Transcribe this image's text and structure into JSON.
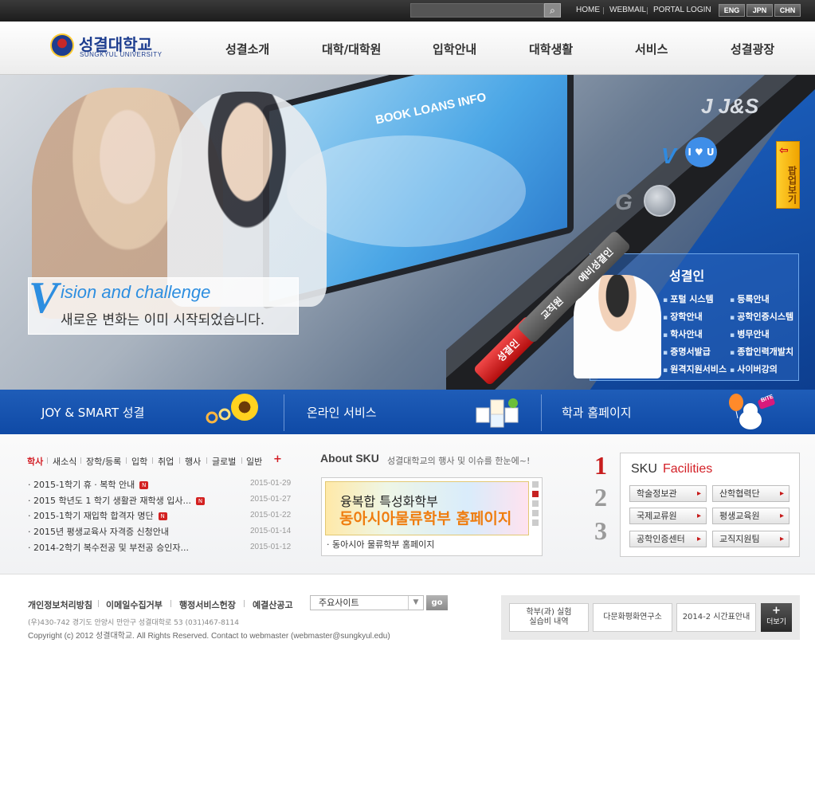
{
  "topbar": {
    "search_placeholder": "",
    "links": [
      "HOME",
      "WEBMAIL",
      "PORTAL LOGIN"
    ],
    "languages": [
      "ENG",
      "JPN",
      "CHN"
    ]
  },
  "header": {
    "logo_ko": "성결대학교",
    "logo_en": "SUNGKYUL UNIVERSITY",
    "nav": [
      "성결소개",
      "대학/대학원",
      "입학안내",
      "대학생활",
      "서비스",
      "성결광장"
    ]
  },
  "hero": {
    "board_title": "BOOK LOANS INFO",
    "vision_v": "V",
    "vision_title": "ision and challenge",
    "vision_sub": "새로운 변화는 이미 시작되었습니다.",
    "letter_js": "J J&S",
    "letter_v": "V",
    "bubble_text": "I ♥ U",
    "letter_g": "G",
    "popup_label": "팝업보기",
    "tabs": [
      "성결인",
      "교직원",
      "예비성결인"
    ],
    "portal_title": "성결인",
    "portal_links_left": [
      "포털 시스템",
      "장학안내",
      "학사안내",
      "증명서발급",
      "원격지원서비스"
    ],
    "portal_links_right": [
      "등록안내",
      "공학인증시스템",
      "병무안내",
      "종합인력개발치",
      "사이버강의"
    ]
  },
  "quickbar": {
    "items": [
      "JOY & SMART 성결",
      "온라인 서비스",
      "학과 홈페이지"
    ],
    "bite_label": "BITE"
  },
  "news": {
    "tabs": [
      "학사",
      "새소식",
      "장학/등록",
      "입학",
      "취업",
      "행사",
      "글로벌",
      "일반"
    ],
    "plus": "+",
    "new_badge": "N",
    "items": [
      {
        "title": "· 2015-1학기 휴 · 복학 안내",
        "date": "2015-01-29",
        "is_new": true
      },
      {
        "title": "· 2015 학년도 1 학기 생활관 재학생 입사...",
        "date": "2015-01-27",
        "is_new": true
      },
      {
        "title": "· 2015-1학기 재입학 합격자 명단",
        "date": "2015-01-22",
        "is_new": true
      },
      {
        "title": "· 2015년 평생교육사 자격증 신청안내",
        "date": "2015-01-14",
        "is_new": false
      },
      {
        "title": "· 2014-2학기 복수전공 및 부전공 승인자...",
        "date": "2015-01-12",
        "is_new": false
      }
    ]
  },
  "about": {
    "title": "About SKU",
    "subtitle": "성결대학교의 행사 및 이슈를 한눈에~!",
    "banner_line1": "융복합 특성화학부",
    "banner_line2": "동아시아물류학부 홈페이지",
    "caption": "· 동아시아 물류학부 홈페이지"
  },
  "facilities": {
    "numbers": [
      "1",
      "2",
      "3"
    ],
    "title_a": "SKU",
    "title_b": "Facilities",
    "buttons": [
      "학술정보관",
      "산학협력단",
      "국제교류원",
      "평생교육원",
      "공학인증센터",
      "교직지원팀"
    ]
  },
  "footer": {
    "links": [
      "개인정보처리방침",
      "이메일수집거부",
      "행정서비스헌장",
      "예결산공고"
    ],
    "site_select": "주요사이트",
    "go_label": "go",
    "address": "(우)430-742 경기도 안양시 만안구 성결대학로 53   (031)467-8114",
    "copyright": "Copyright (c) 2012 성결대학교. All Rights Reserved. Contact to webmaster (webmaster@sungkyul.edu)",
    "banners": [
      "학부(과) 실험\n실습비 내역",
      "다문화평화연구소",
      "2014-2 시간표안내"
    ],
    "more_plus": "+",
    "more_label": "더보기"
  },
  "colors": {
    "brand_blue": "#1d3d8f",
    "accent_red": "#d31f26",
    "quickbar_blue": "#1753af",
    "hero_orange": "#ef7d0f"
  }
}
